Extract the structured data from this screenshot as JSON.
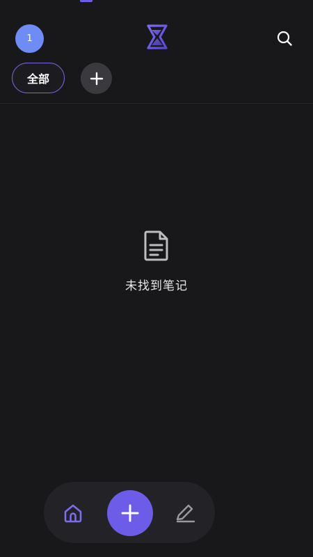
{
  "header": {
    "avatar_text": "1",
    "logo_icon": "hourglass-logo-icon",
    "search_icon": "search-icon"
  },
  "filters": {
    "chips": [
      {
        "label": "全部",
        "selected": true
      }
    ],
    "add_icon": "plus-icon"
  },
  "empty_state": {
    "icon": "document-icon",
    "message": "未找到笔记"
  },
  "bottom_nav": {
    "home_icon": "home-icon",
    "fab_icon": "plus-icon",
    "edit_icon": "pencil-icon"
  },
  "colors": {
    "background": "#18181b",
    "accent": "#6c5ce7",
    "avatar": "#6d8cf5",
    "chip_border": "#7a6ee0",
    "surface": "#232327"
  }
}
